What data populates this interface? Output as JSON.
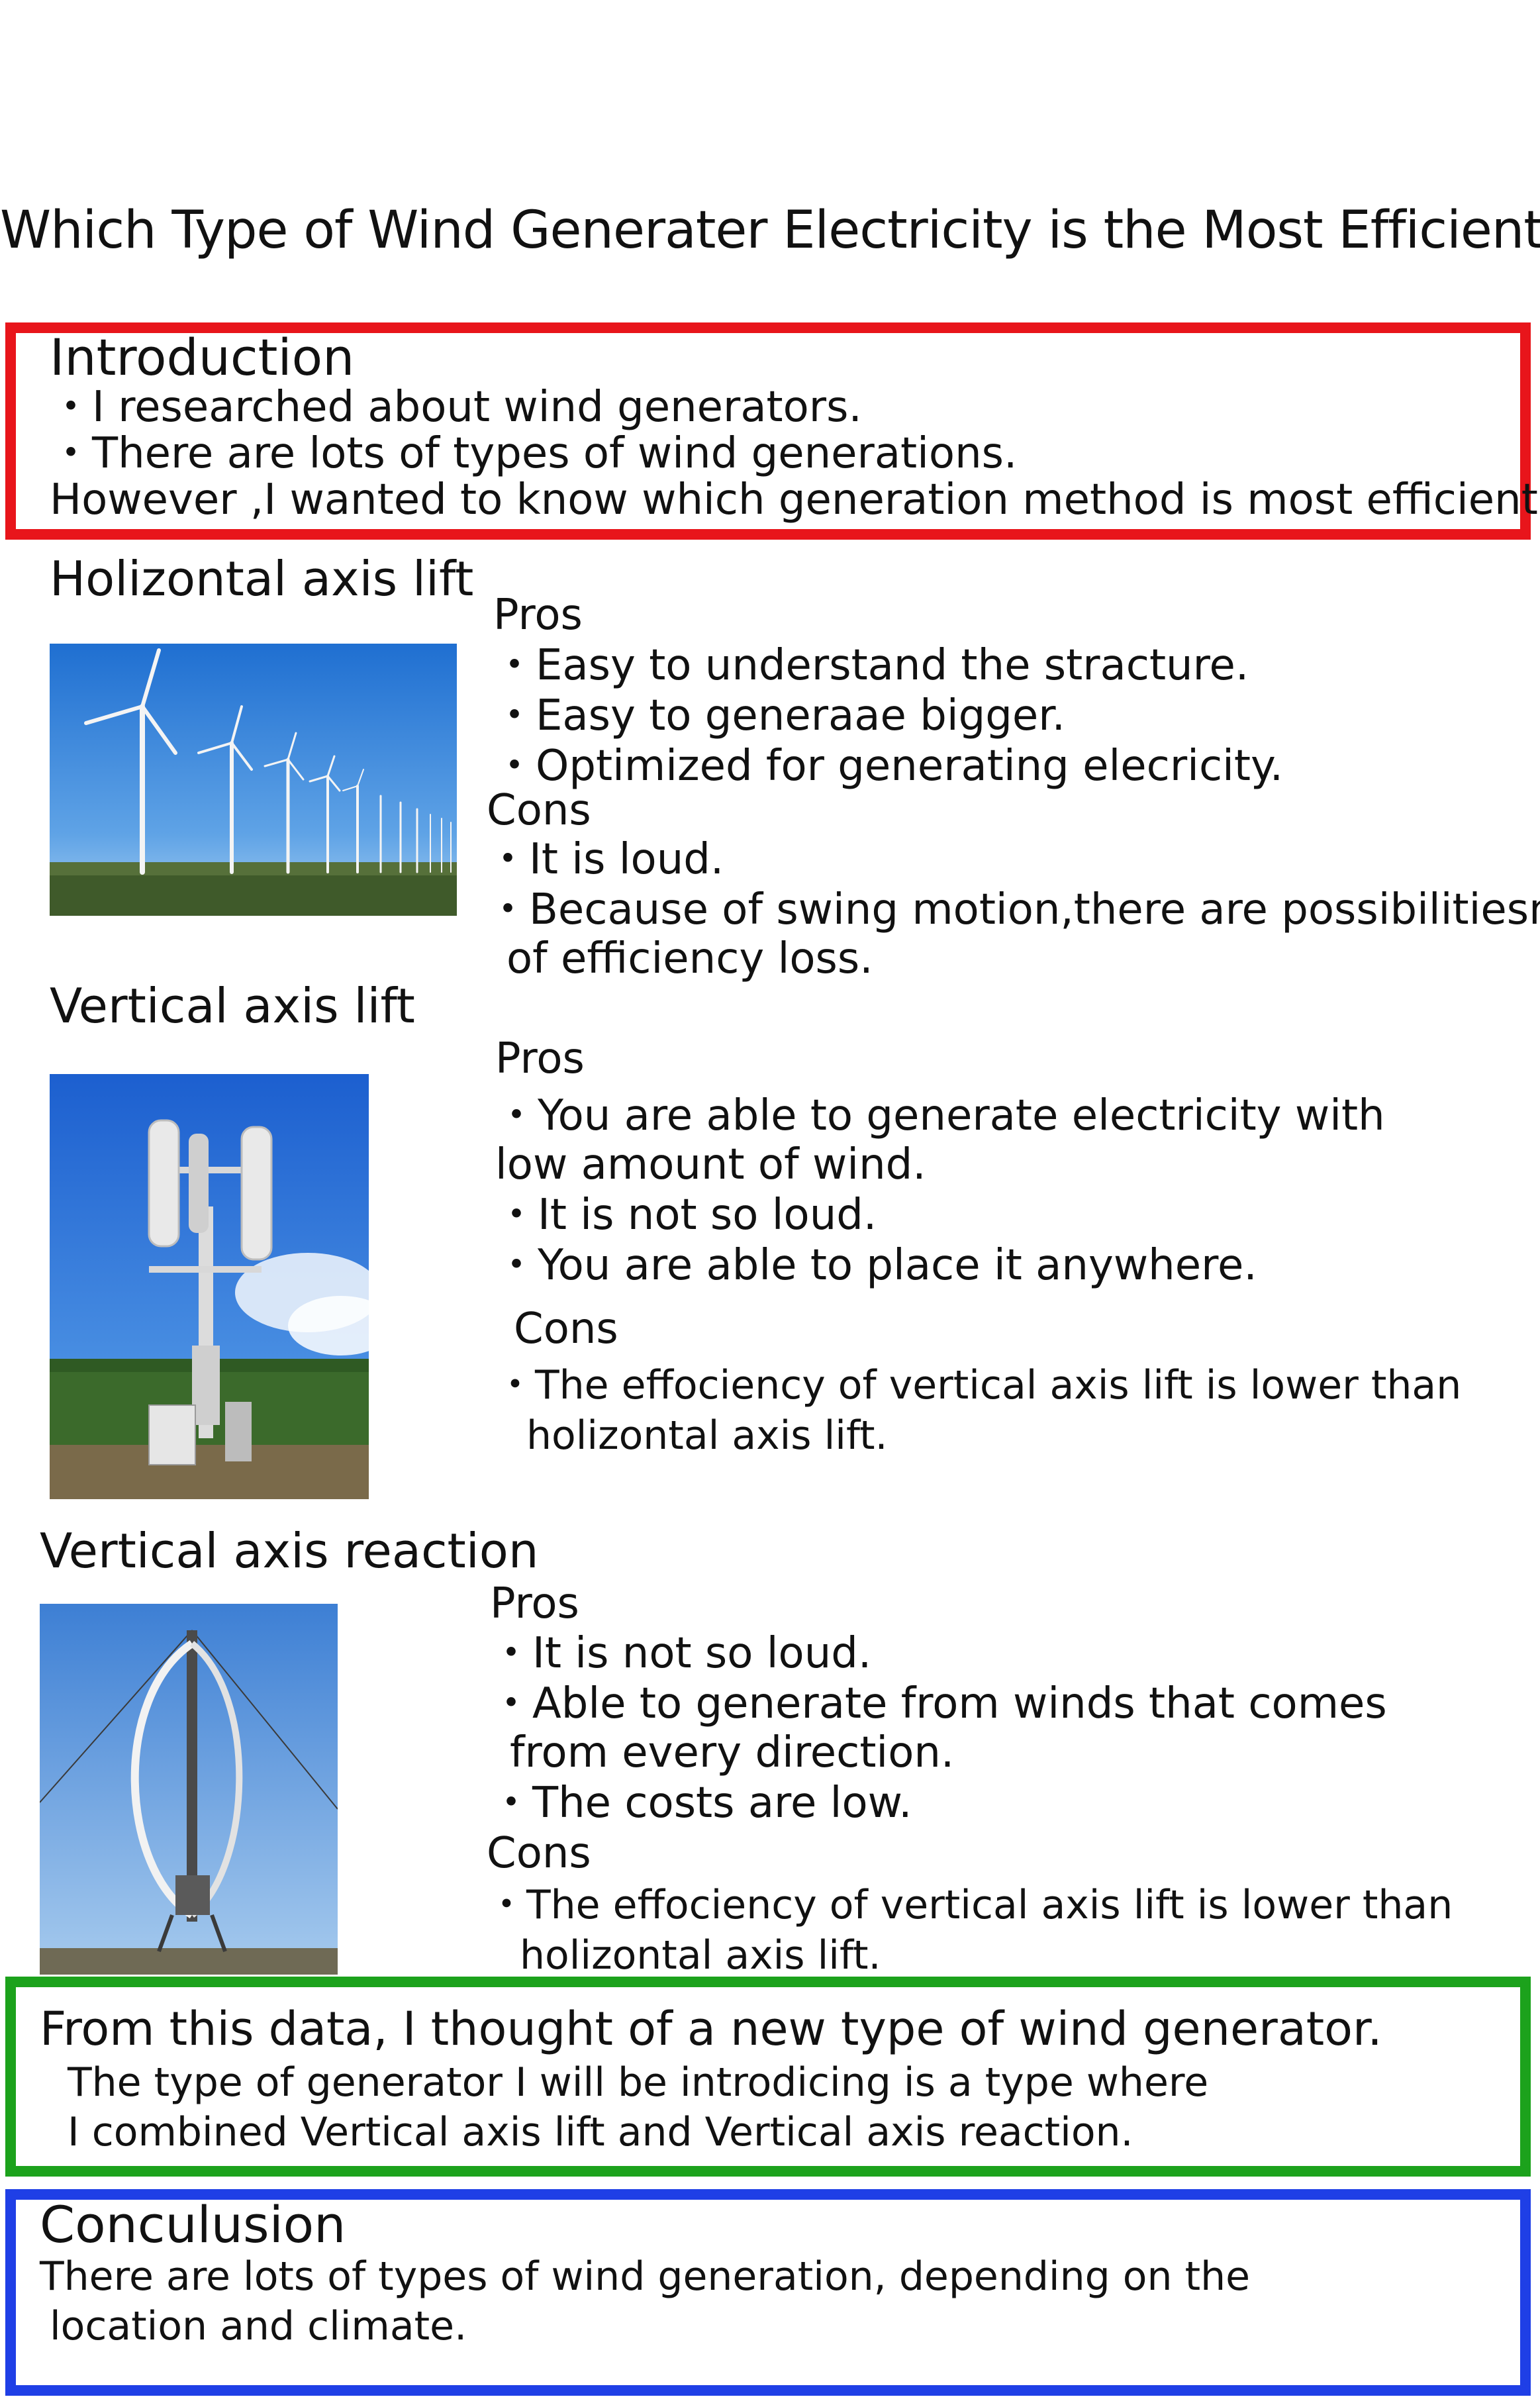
{
  "title": "Which Type of Wind Generater Electricity is the Most Efficient.",
  "introduction": {
    "heading": "Introduction",
    "lines": [
      "・I researched about wind generators.",
      "・There are lots of types of wind generations.",
      "However ,I wanted to know which generation method is most efficient."
    ]
  },
  "sections": [
    {
      "heading": "Holizontal axis lift",
      "pros_label": "Pros",
      "pros": [
        "・Easy to understand the stracture.",
        "・Easy to generaae bigger.",
        "・Optimized for generating elecricity."
      ],
      "cons_label": "Cons",
      "cons": [
        "・It is loud.",
        "・Because of swing motion,there are possibilitiesn",
        "of efficiency loss."
      ]
    },
    {
      "heading": "Vertical axis lift",
      "pros_label": "Pros",
      "pros": [
        "・You are able to generate electricity with",
        "low amount of wind.",
        "・It is not so loud.",
        "・You are able to place it anywhere."
      ],
      "cons_label": "Cons",
      "cons": [
        "・The effociency of vertical axis lift is lower than",
        "holizontal axis lift."
      ]
    },
    {
      "heading": "Vertical axis reaction",
      "pros_label": "Pros",
      "pros": [
        "・It is not so loud.",
        "・Able to generate from winds that comes",
        "from every direction.",
        "・The costs are low."
      ],
      "cons_label": "Cons",
      "cons": [
        "・The effociency of vertical axis lift is lower than",
        "holizontal axis lift."
      ]
    }
  ],
  "idea": {
    "heading": "From this data, I thought of a new type of wind generator.",
    "lines": [
      "The type of generator I will be introdicing is a type where",
      "I combined Vertical axis lift and Vertical axis reaction."
    ]
  },
  "conclusion": {
    "heading": "Conculusion",
    "lines": [
      "There are lots of types of wind generation, depending on the",
      "location and climate."
    ]
  },
  "colors": {
    "intro_border": "#e8151b",
    "idea_border": "#1ca21c",
    "conclusion_border": "#1f3fe6"
  },
  "images": {
    "photo1": "horizontal-wind-turbine-row-photo",
    "photo2": "vertical-axis-lift-turbine-photo",
    "photo3": "darrieus-vertical-axis-turbine-photo"
  }
}
